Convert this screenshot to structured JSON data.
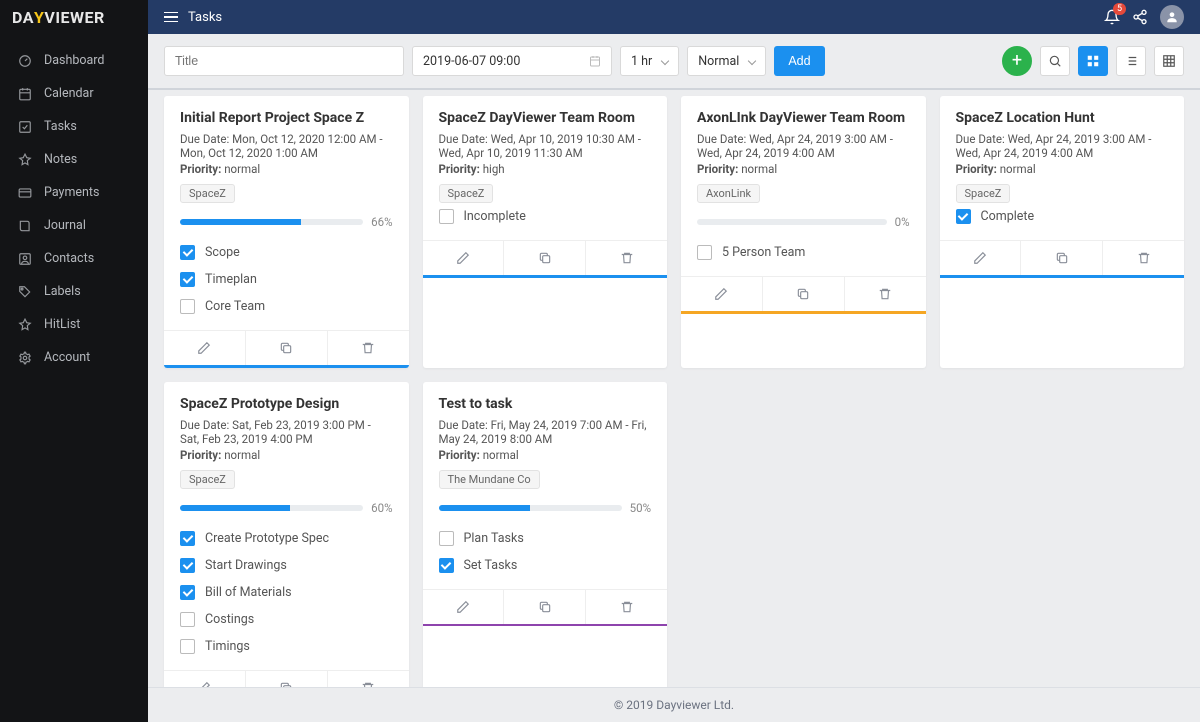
{
  "brand": {
    "pre": "DA",
    "mid": "Y",
    "post": "VIEWER"
  },
  "topbar": {
    "title": "Tasks",
    "notif_count": "5"
  },
  "sidebar": {
    "items": [
      {
        "label": "Dashboard",
        "icon": "gauge"
      },
      {
        "label": "Calendar",
        "icon": "calendar"
      },
      {
        "label": "Tasks",
        "icon": "check-square"
      },
      {
        "label": "Notes",
        "icon": "pin"
      },
      {
        "label": "Payments",
        "icon": "card"
      },
      {
        "label": "Journal",
        "icon": "book"
      },
      {
        "label": "Contacts",
        "icon": "contact"
      },
      {
        "label": "Labels",
        "icon": "tag"
      },
      {
        "label": "HitList",
        "icon": "star"
      },
      {
        "label": "Account",
        "icon": "gear"
      }
    ]
  },
  "toolbar": {
    "title_placeholder": "Title",
    "date_value": "2019-06-07 09:00",
    "duration": "1 hr",
    "priority": "Normal",
    "add_label": "Add"
  },
  "cards": [
    {
      "title": "Initial Report Project Space Z",
      "due": "Due Date: Mon, Oct 12, 2020 12:00 AM - Mon, Oct 12, 2020 1:00 AM",
      "priority": "Priority: normal",
      "tag": "SpaceZ",
      "progress": 66,
      "items": [
        {
          "label": "Scope",
          "checked": true
        },
        {
          "label": "Timeplan",
          "checked": true
        },
        {
          "label": "Core Team",
          "checked": false
        }
      ],
      "accent": "#1b90ef"
    },
    {
      "title": "SpaceZ DayViewer Team Room",
      "due": "Due Date: Wed, Apr 10, 2019 10:30 AM - Wed, Apr 10, 2019 11:30 AM",
      "priority": "Priority: high",
      "tag": "SpaceZ",
      "progress": null,
      "items": [
        {
          "label": "Incomplete",
          "checked": false
        }
      ],
      "accent": "#1b90ef"
    },
    {
      "title": "AxonLInk DayViewer Team Room",
      "due": "Due Date: Wed, Apr 24, 2019 3:00 AM - Wed, Apr 24, 2019 4:00 AM",
      "priority": "Priority: normal",
      "tag": "AxonLink",
      "progress": 0,
      "items": [
        {
          "label": "5 Person Team",
          "checked": false
        }
      ],
      "accent": "#f5a623"
    },
    {
      "title": "SpaceZ Location Hunt",
      "due": "Due Date: Wed, Apr 24, 2019 3:00 AM - Wed, Apr 24, 2019 4:00 AM",
      "priority": "Priority: normal",
      "tag": "SpaceZ",
      "progress": null,
      "items": [
        {
          "label": "Complete",
          "checked": true
        }
      ],
      "accent": "#1b90ef"
    },
    {
      "title": "SpaceZ Prototype Design",
      "due": "Due Date: Sat, Feb 23, 2019 3:00 PM - Sat, Feb 23, 2019 4:00 PM",
      "priority": "Priority: normal",
      "tag": "SpaceZ",
      "progress": 60,
      "items": [
        {
          "label": "Create Prototype Spec",
          "checked": true
        },
        {
          "label": "Start Drawings",
          "checked": true
        },
        {
          "label": "Bill of Materials",
          "checked": true
        },
        {
          "label": "Costings",
          "checked": false
        },
        {
          "label": "Timings",
          "checked": false
        }
      ],
      "accent": "#1b90ef"
    },
    {
      "title": "Test to task",
      "due": "Due Date: Fri, May 24, 2019 7:00 AM - Fri, May 24, 2019 8:00 AM",
      "priority": "Priority: normal",
      "tag": "The Mundane Co",
      "progress": 50,
      "items": [
        {
          "label": "Plan Tasks",
          "checked": false
        },
        {
          "label": "Set Tasks",
          "checked": true
        }
      ],
      "accent": "#8e44ad"
    }
  ],
  "footer": "© 2019 Dayviewer Ltd."
}
